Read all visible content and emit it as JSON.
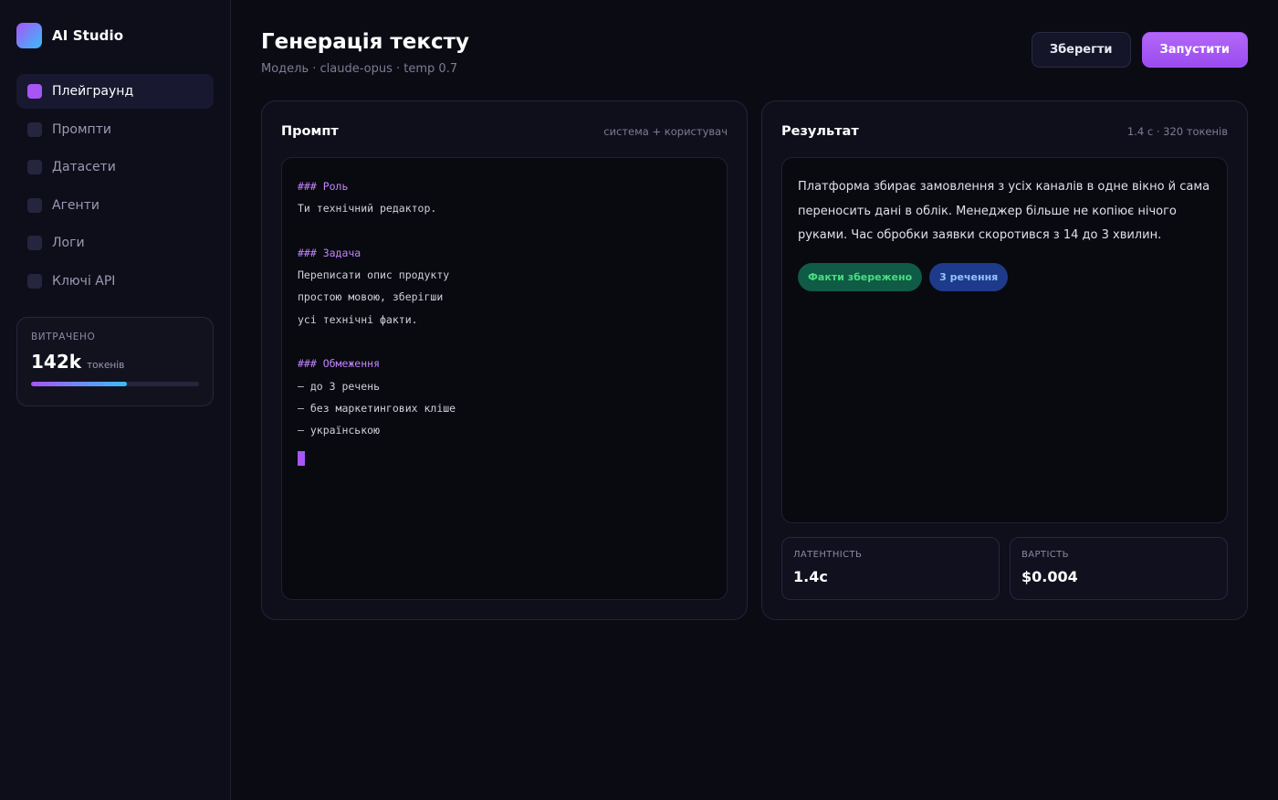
{
  "brand": {
    "name": "AI Studio"
  },
  "sidebar": {
    "items": [
      {
        "label": "Плейграунд",
        "active": true
      },
      {
        "label": "Промпти",
        "active": false
      },
      {
        "label": "Датасети",
        "active": false
      },
      {
        "label": "Агенти",
        "active": false
      },
      {
        "label": "Логи",
        "active": false
      },
      {
        "label": "Ключі API",
        "active": false
      }
    ],
    "usage": {
      "label": "Витрачено",
      "value": "142k",
      "unit": "токенів",
      "progress_percent": 57
    }
  },
  "header": {
    "title": "Генерація тексту",
    "subtitle": "Модель · claude-opus · temp 0.7",
    "save_label": "Зберегти",
    "run_label": "Запустити"
  },
  "prompt_panel": {
    "title": "Промпт",
    "meta": "система + користувач",
    "lines": [
      {
        "text": "### Роль",
        "heading": true
      },
      {
        "text": "Ти технічний редактор.",
        "heading": false
      },
      {
        "text": "",
        "heading": false
      },
      {
        "text": "### Задача",
        "heading": true
      },
      {
        "text": "Переписати опис продукту",
        "heading": false
      },
      {
        "text": "простою мовою, зберігши",
        "heading": false
      },
      {
        "text": "усі технічні факти.",
        "heading": false
      },
      {
        "text": "",
        "heading": false
      },
      {
        "text": "### Обмеження",
        "heading": true
      },
      {
        "text": "— до 3 речень",
        "heading": false
      },
      {
        "text": "— без маркетингових кліше",
        "heading": false
      },
      {
        "text": "— українською",
        "heading": false
      }
    ]
  },
  "result_panel": {
    "title": "Результат",
    "meta": "1.4 с · 320 токенів",
    "text": "Платформа збирає замовлення з усіх каналів в одне вікно й сама переносить дані в облік. Менеджер більше не копіює нічого руками. Час обробки заявки скоротився з 14 до 3 хвилин.",
    "badges": [
      {
        "label": "Факти збережено",
        "color": "#4ade80"
      },
      {
        "label": "3 речення",
        "color": "#93c5fd"
      }
    ],
    "stats": [
      {
        "label": "Латентність",
        "value": "1.4с"
      },
      {
        "label": "Вартість",
        "value": "$0.004"
      }
    ]
  },
  "colors": {
    "accent": "#a855f7",
    "accent_secondary": "#38bdf8",
    "background": "#0b0b14"
  }
}
